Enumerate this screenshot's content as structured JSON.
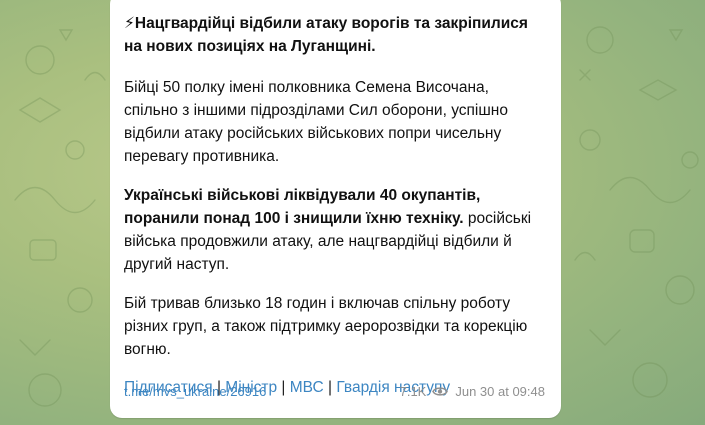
{
  "post": {
    "headline_icon": "⚡",
    "headline": "Нацгвардійці відбили атаку ворогів та закріпилися на нових позиціях на Луганщині.",
    "paragraph1": "Бійці 50 полку імені полковника Семена Височана, спільно з іншими підрозділами Сил оборони, успішно відбили атаку російських військових попри чисельну перевагу противника.",
    "paragraph2_bold": "Українські військові ліквідували 40 окупантів, поранили понад 100 і знищили їхню техніку.",
    "paragraph2_rest": " російські війська продовжили атаку, але нацгвардійці відбили й другий наступ.",
    "paragraph3": "Бій тривав близько 18 годин і включав спільну роботу різних груп, а також підтримку аеророзвідки та корекцію вогню.",
    "links": [
      {
        "label": "Підписатися"
      },
      {
        "label": "Міністр"
      },
      {
        "label": "МВС"
      },
      {
        "label": "Гвардія наступу"
      }
    ],
    "separator": "|",
    "source_link": "t.me/mvs_ukraine/26916",
    "views": "7.1K",
    "date": "Jun 30 at 09:48"
  },
  "colors": {
    "link": "#3d86c2",
    "meta": "#8f8f8f",
    "background": "#a9bf7f"
  },
  "icons": {
    "headline": "lightning-emoji",
    "views": "eye-icon"
  }
}
